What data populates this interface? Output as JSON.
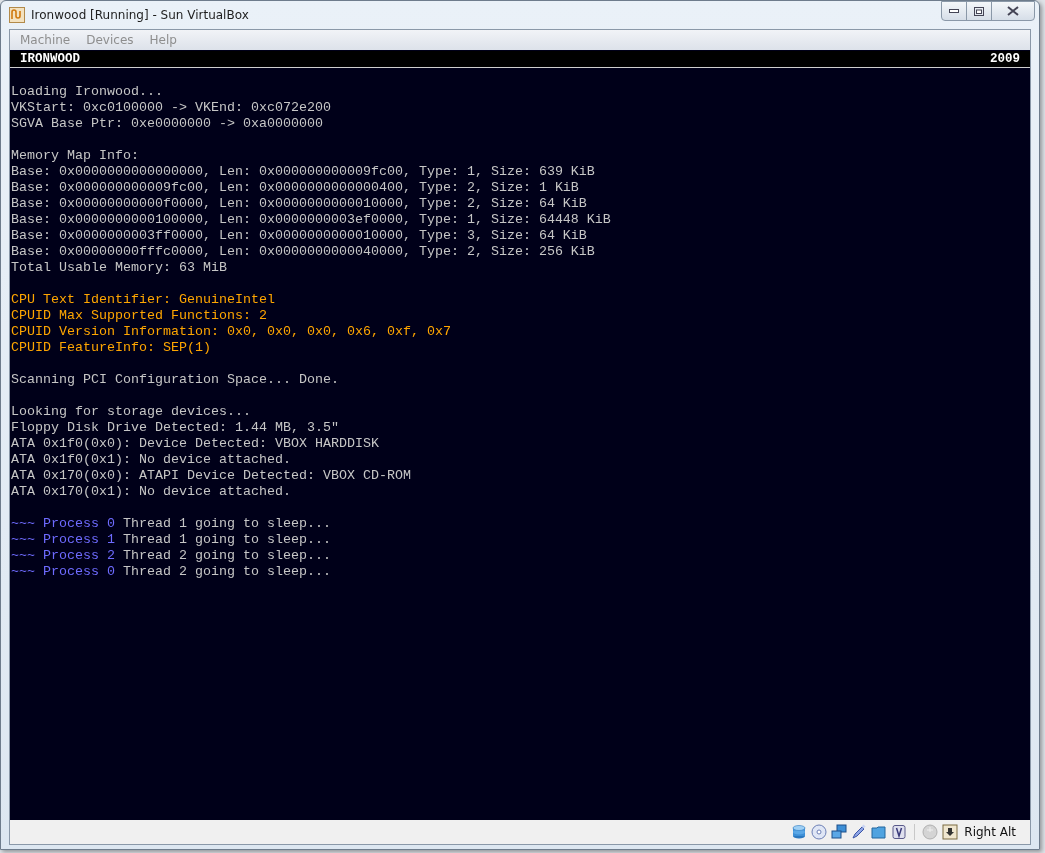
{
  "window": {
    "title": "Ironwood [Running] - Sun VirtualBox"
  },
  "menu": [
    {
      "label": "Machine"
    },
    {
      "label": "Devices"
    },
    {
      "label": "Help"
    }
  ],
  "header": {
    "title": "IRONWOOD",
    "year": "2009"
  },
  "console": [
    {
      "kind": "blank"
    },
    {
      "kind": "text",
      "segments": [
        {
          "kind": "plain",
          "text": "Loading Ironwood..."
        }
      ]
    },
    {
      "kind": "text",
      "segments": [
        {
          "kind": "plain",
          "text": "VKStart: 0xc0100000 -> VKEnd: 0xc072e200"
        }
      ]
    },
    {
      "kind": "text",
      "segments": [
        {
          "kind": "plain",
          "text": "SGVA Base Ptr: 0xe0000000 -> 0xa0000000"
        }
      ]
    },
    {
      "kind": "blank"
    },
    {
      "kind": "text",
      "segments": [
        {
          "kind": "plain",
          "text": "Memory Map Info:"
        }
      ]
    },
    {
      "kind": "text",
      "segments": [
        {
          "kind": "plain",
          "text": "Base: 0x0000000000000000, Len: 0x000000000009fc00, Type: 1, Size: 639 KiB"
        }
      ]
    },
    {
      "kind": "text",
      "segments": [
        {
          "kind": "plain",
          "text": "Base: 0x000000000009fc00, Len: 0x0000000000000400, Type: 2, Size: 1 KiB"
        }
      ]
    },
    {
      "kind": "text",
      "segments": [
        {
          "kind": "plain",
          "text": "Base: 0x00000000000f0000, Len: 0x0000000000010000, Type: 2, Size: 64 KiB"
        }
      ]
    },
    {
      "kind": "text",
      "segments": [
        {
          "kind": "plain",
          "text": "Base: 0x0000000000100000, Len: 0x0000000003ef0000, Type: 1, Size: 64448 KiB"
        }
      ]
    },
    {
      "kind": "text",
      "segments": [
        {
          "kind": "plain",
          "text": "Base: 0x0000000003ff0000, Len: 0x0000000000010000, Type: 3, Size: 64 KiB"
        }
      ]
    },
    {
      "kind": "text",
      "segments": [
        {
          "kind": "plain",
          "text": "Base: 0x00000000fffc0000, Len: 0x0000000000040000, Type: 2, Size: 256 KiB"
        }
      ]
    },
    {
      "kind": "text",
      "segments": [
        {
          "kind": "plain",
          "text": "Total Usable Memory: 63 MiB"
        }
      ]
    },
    {
      "kind": "blank"
    },
    {
      "kind": "text",
      "segments": [
        {
          "kind": "cpu",
          "text": "CPU Text Identifier: GenuineIntel"
        }
      ]
    },
    {
      "kind": "text",
      "segments": [
        {
          "kind": "cpu",
          "text": "CPUID Max Supported Functions: 2"
        }
      ]
    },
    {
      "kind": "text",
      "segments": [
        {
          "kind": "cpu",
          "text": "CPUID Version Information: 0x0, 0x0, 0x0, 0x6, 0xf, 0x7"
        }
      ]
    },
    {
      "kind": "text",
      "segments": [
        {
          "kind": "cpu",
          "text": "CPUID FeatureInfo: SEP(1)"
        }
      ]
    },
    {
      "kind": "blank"
    },
    {
      "kind": "text",
      "segments": [
        {
          "kind": "plain",
          "text": "Scanning PCI Configuration Space... Done."
        }
      ]
    },
    {
      "kind": "blank"
    },
    {
      "kind": "text",
      "segments": [
        {
          "kind": "plain",
          "text": "Looking for storage devices..."
        }
      ]
    },
    {
      "kind": "text",
      "segments": [
        {
          "kind": "plain",
          "text": "Floppy Disk Drive Detected: 1.44 MB, 3.5\""
        }
      ]
    },
    {
      "kind": "text",
      "segments": [
        {
          "kind": "plain",
          "text": "ATA 0x1f0(0x0): Device Detected: VBOX HARDDISK"
        }
      ]
    },
    {
      "kind": "text",
      "segments": [
        {
          "kind": "plain",
          "text": "ATA 0x1f0(0x1): No device attached."
        }
      ]
    },
    {
      "kind": "text",
      "segments": [
        {
          "kind": "plain",
          "text": "ATA 0x170(0x0): ATAPI Device Detected: VBOX CD-ROM"
        }
      ]
    },
    {
      "kind": "text",
      "segments": [
        {
          "kind": "plain",
          "text": "ATA 0x170(0x1): No device attached."
        }
      ]
    },
    {
      "kind": "blank"
    },
    {
      "kind": "text",
      "segments": [
        {
          "kind": "process",
          "text": "~~~ Process 0"
        },
        {
          "kind": "plain",
          "text": "Thread 1 going to sleep..."
        }
      ]
    },
    {
      "kind": "text",
      "segments": [
        {
          "kind": "process",
          "text": "~~~ Process 1"
        },
        {
          "kind": "plain",
          "text": "Thread 1 going to sleep..."
        }
      ]
    },
    {
      "kind": "text",
      "segments": [
        {
          "kind": "process",
          "text": "~~~ Process 2"
        },
        {
          "kind": "plain",
          "text": "Thread 2 going to sleep..."
        }
      ]
    },
    {
      "kind": "text",
      "segments": [
        {
          "kind": "process",
          "text": "~~~ Process 0"
        },
        {
          "kind": "plain",
          "text": "Thread 2 going to sleep..."
        }
      ]
    }
  ],
  "status_bar": {
    "host_key": "Right Alt"
  }
}
